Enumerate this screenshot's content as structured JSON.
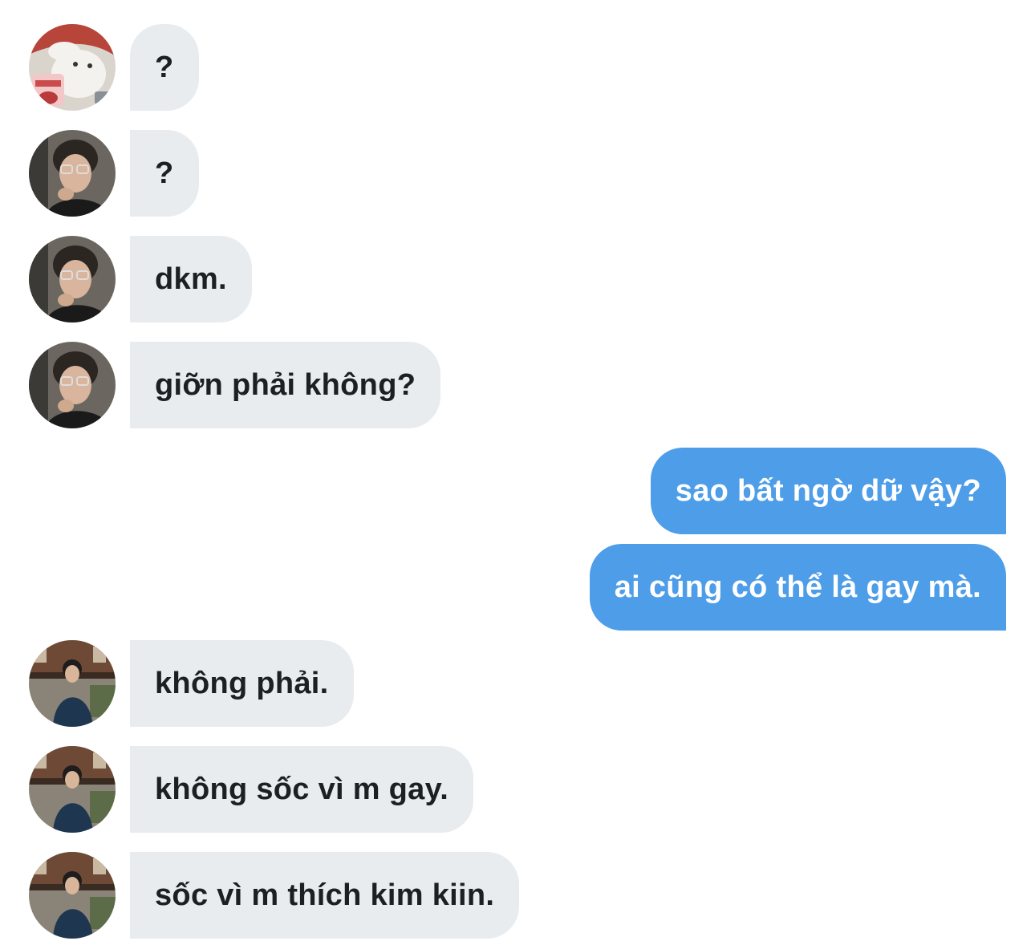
{
  "conversation": {
    "messages": [
      {
        "sender": "incoming",
        "avatar": "bear-avatar",
        "text": "?"
      },
      {
        "sender": "incoming",
        "avatar": "boy-glasses-avatar",
        "text": "?"
      },
      {
        "sender": "incoming",
        "avatar": "boy-glasses-avatar",
        "text": "dkm."
      },
      {
        "sender": "incoming",
        "avatar": "boy-glasses-avatar",
        "text": "giỡn phải không?"
      },
      {
        "sender": "outgoing",
        "text": "sao bất ngờ dữ vậy?"
      },
      {
        "sender": "outgoing",
        "text": "ai cũng có thể là gay mà."
      },
      {
        "sender": "incoming",
        "avatar": "boy-street-avatar",
        "text": "không phải."
      },
      {
        "sender": "incoming",
        "avatar": "boy-street-avatar",
        "text": "không sốc vì m gay."
      },
      {
        "sender": "incoming",
        "avatar": "boy-street-avatar",
        "text": "sốc vì m thích kim kiin."
      }
    ]
  },
  "colors": {
    "incoming_bubble": "#e8ecef",
    "incoming_text": "#1c1f23",
    "outgoing_bubble": "#4d9de8",
    "outgoing_text": "#ffffff"
  }
}
